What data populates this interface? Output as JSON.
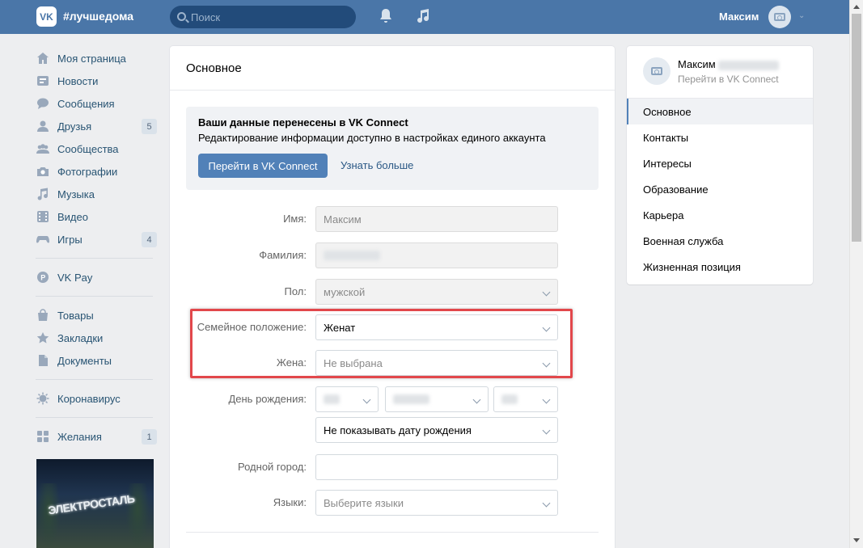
{
  "header": {
    "logo": "VK",
    "hashtag": "#лучшедома",
    "search_placeholder": "Поиск",
    "user_name": "Максим"
  },
  "left_nav": {
    "items": [
      {
        "label": "Моя страница",
        "icon": "home-icon"
      },
      {
        "label": "Новости",
        "icon": "news-icon"
      },
      {
        "label": "Сообщения",
        "icon": "messages-icon"
      },
      {
        "label": "Друзья",
        "icon": "friends-icon",
        "badge": "5"
      },
      {
        "label": "Сообщества",
        "icon": "groups-icon"
      },
      {
        "label": "Фотографии",
        "icon": "camera-icon"
      },
      {
        "label": "Музыка",
        "icon": "music-icon"
      },
      {
        "label": "Видео",
        "icon": "video-icon"
      },
      {
        "label": "Игры",
        "icon": "gamepad-icon",
        "badge": "4"
      }
    ],
    "pay": {
      "label": "VK Pay",
      "icon": "vkpay-icon"
    },
    "items2": [
      {
        "label": "Товары",
        "icon": "shopping-bag-icon"
      },
      {
        "label": "Закладки",
        "icon": "star-icon"
      },
      {
        "label": "Документы",
        "icon": "document-icon"
      }
    ],
    "corona": {
      "label": "Коронавирус",
      "icon": "virus-icon"
    },
    "wishes": {
      "label": "Желания",
      "icon": "grid-icon",
      "badge": "1"
    },
    "promo_text": "ЭЛЕКТРОСТАЛЬ"
  },
  "main": {
    "title": "Основное",
    "notice": {
      "title": "Ваши данные перенесены в VK Connect",
      "text": "Редактирование информации доступно в настройках единого аккаунта",
      "button": "Перейти в VK Connect",
      "link": "Узнать больше"
    },
    "fields": {
      "first_name": {
        "label": "Имя:",
        "value": "Максим"
      },
      "last_name": {
        "label": "Фамилия:"
      },
      "gender": {
        "label": "Пол:",
        "value": "мужской"
      },
      "relationship": {
        "label": "Семейное положение:",
        "value": "Женат"
      },
      "spouse": {
        "label": "Жена:",
        "value": "Не выбрана"
      },
      "birthday": {
        "label": "День рождения:",
        "visibility": "Не показывать дату рождения"
      },
      "hometown": {
        "label": "Родной город:",
        "value": ""
      },
      "languages": {
        "label": "Языки:",
        "placeholder": "Выберите языки"
      }
    }
  },
  "right_nav": {
    "name": "Максим",
    "subtitle": "Перейти в VK Connect",
    "items": [
      "Основное",
      "Контакты",
      "Интересы",
      "Образование",
      "Карьера",
      "Военная служба",
      "Жизненная позиция"
    ],
    "active": "Основное"
  },
  "colors": {
    "header": "#4a76a8",
    "accent": "#5181b8",
    "highlight": "#e2474b",
    "background": "#edeef0"
  }
}
